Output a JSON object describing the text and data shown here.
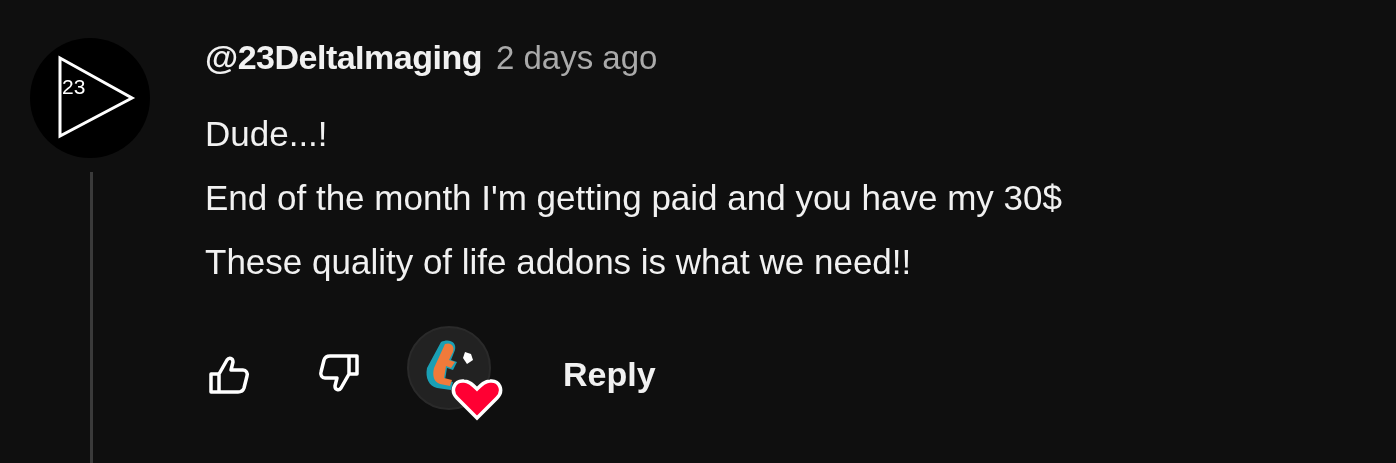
{
  "comment": {
    "avatar_text": "23",
    "author": "@23DeltaImaging",
    "time": "2 days ago",
    "lines": [
      "Dude...!",
      "End of the month I'm getting paid and you have my 30$",
      "These quality of life addons is what we need!!"
    ],
    "hearted_by_creator": true,
    "reply": "Reply"
  }
}
